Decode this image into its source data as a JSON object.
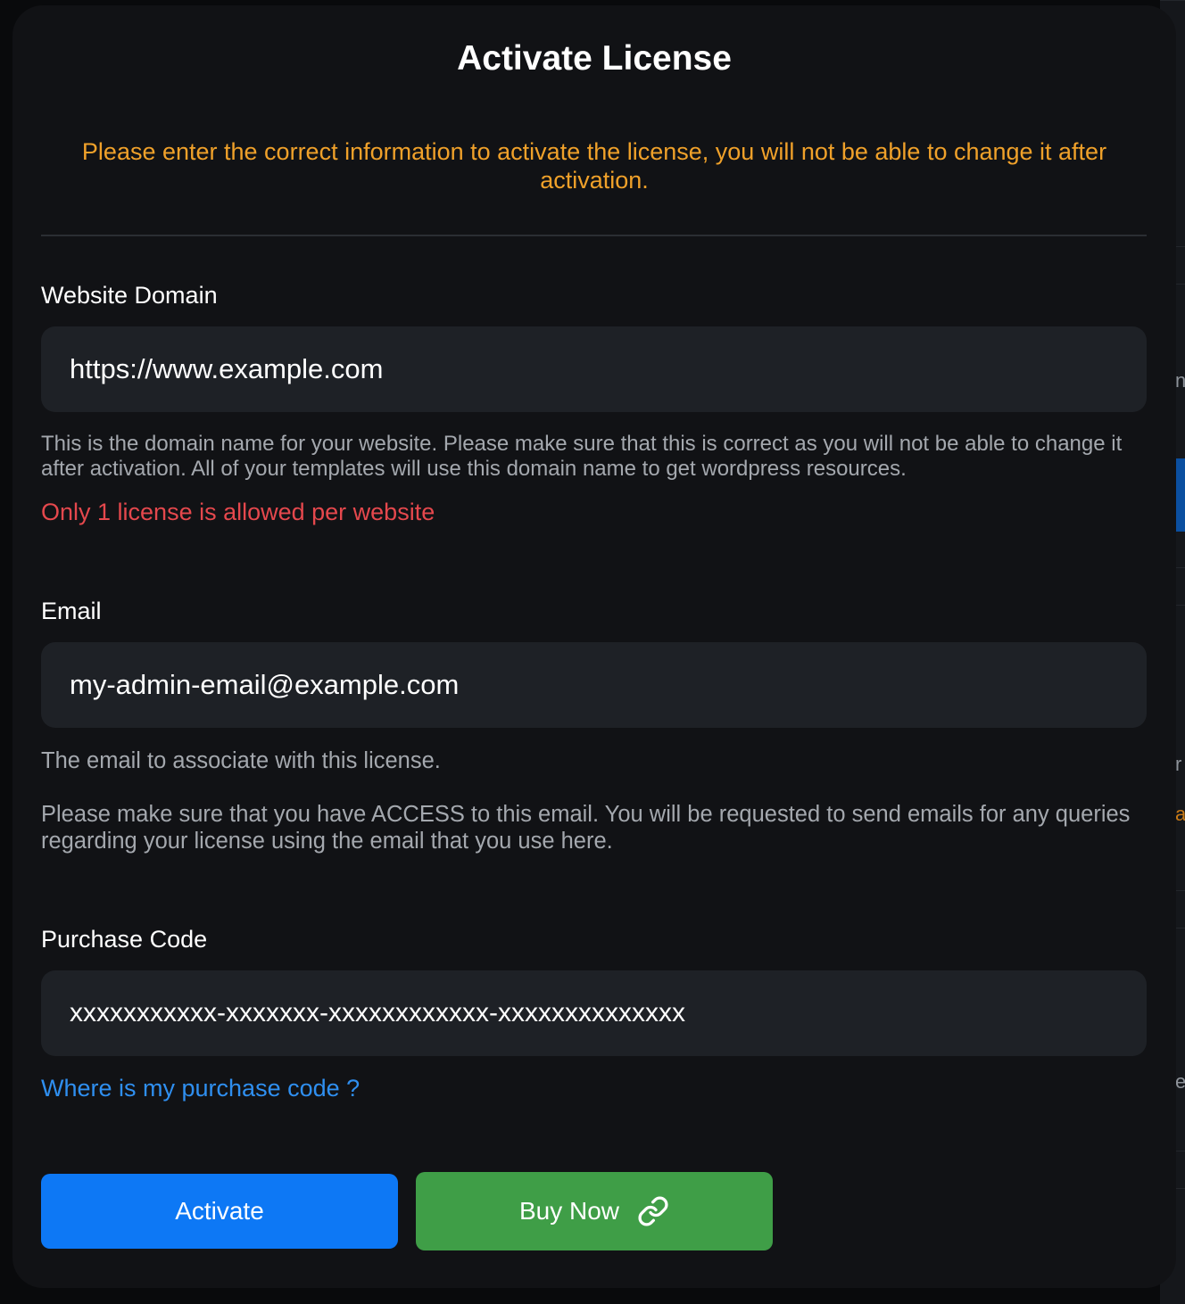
{
  "dialog": {
    "title": "Activate License",
    "warning": "Please enter the correct information to activate the license, you will not be able to change it after activation."
  },
  "domain_field": {
    "label": "Website Domain",
    "value": "https://www.example.com",
    "help": "This is the domain name for your website. Please make sure that this is correct as you will not be able to change it after activation. All of your templates will use this domain name to get wordpress resources.",
    "error": "Only 1 license is allowed per website"
  },
  "email_field": {
    "label": "Email",
    "value": "my-admin-email@example.com",
    "help_1": "The email to associate with this license.",
    "help_2": "Please make sure that you have ACCESS to this email. You will be requested to send emails for any queries regarding your license using the email that you use here."
  },
  "purchase_field": {
    "label": "Purchase Code",
    "value": "xxxxxxxxxxx-xxxxxxx-xxxxxxxxxxxx-xxxxxxxxxxxxxx",
    "help_link": "Where is my purchase code ?"
  },
  "actions": {
    "activate_label": "Activate",
    "buy_label": "Buy Now",
    "buy_icon": "link-icon"
  },
  "colors": {
    "warning": "#f0a12a",
    "error": "#e5484d",
    "link": "#2f8ff0",
    "primary": "#0d78f5",
    "success": "#3f9e47"
  },
  "background_page": {
    "letters": [
      "n",
      "r",
      "a",
      "e"
    ]
  }
}
